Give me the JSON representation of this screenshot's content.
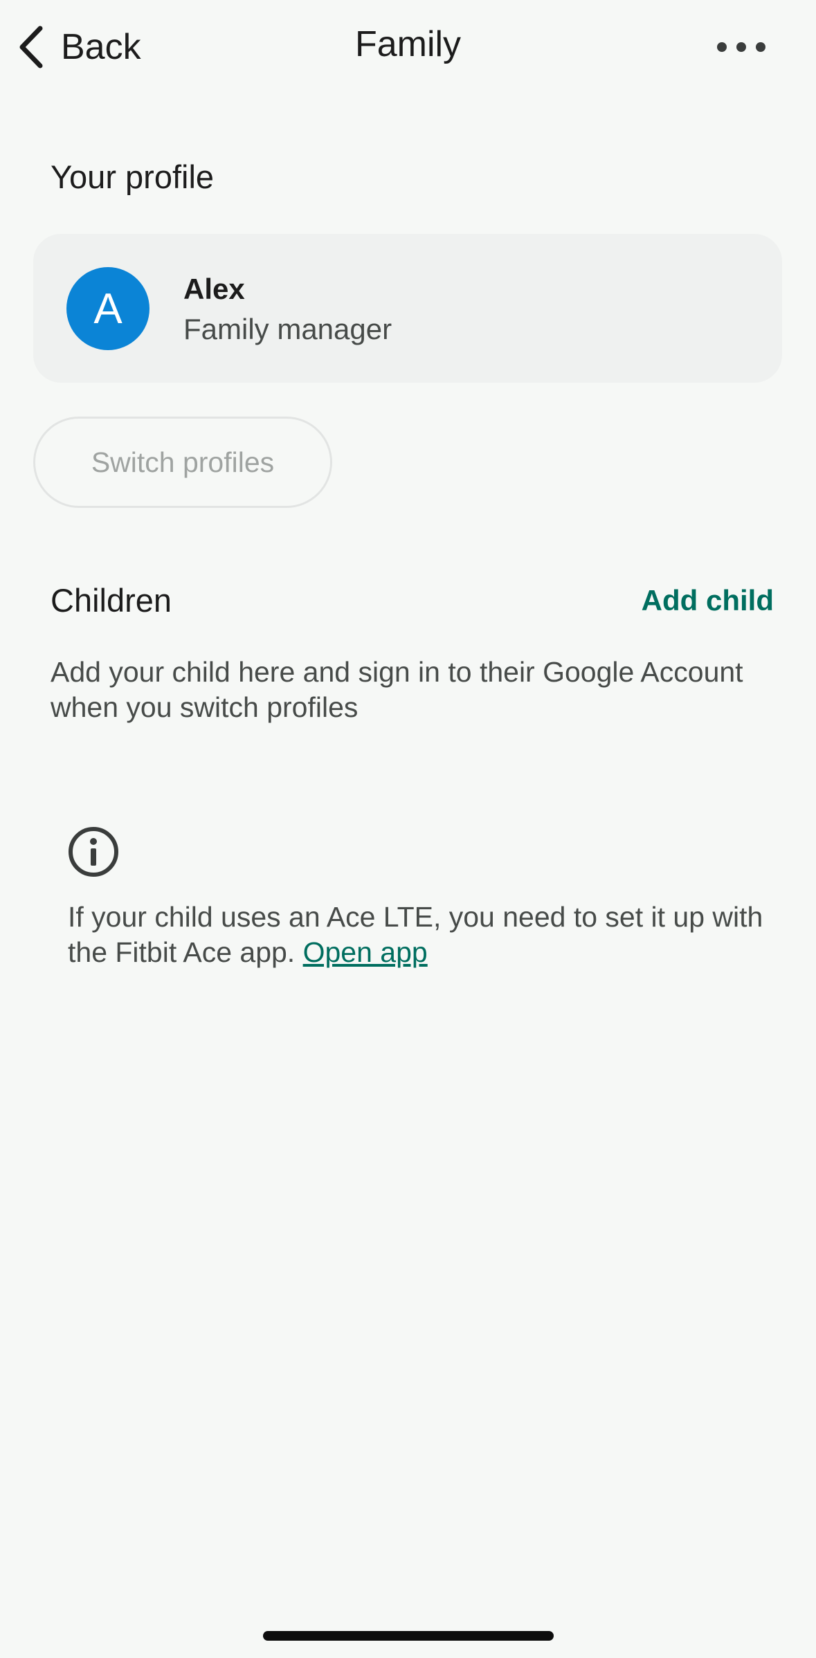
{
  "header": {
    "back_label": "Back",
    "title": "Family",
    "more_icon": "more-horizontal-icon"
  },
  "profile_section": {
    "heading": "Your profile",
    "card": {
      "avatar_initial": "A",
      "avatar_color": "#0b84d6",
      "name": "Alex",
      "role": "Family manager"
    },
    "switch_button_label": "Switch profiles"
  },
  "children_section": {
    "heading": "Children",
    "add_child_label": "Add child",
    "description": "Add your child here and sign in to their Google Account when you switch profiles"
  },
  "info_notice": {
    "icon": "info-icon",
    "text": "If your child uses an Ace LTE, you need to set it up with the Fitbit Ace app.",
    "link_label": "Open app"
  },
  "colors": {
    "accent": "#006e5f",
    "background": "#f6f8f6",
    "card": "#eff1f0"
  }
}
